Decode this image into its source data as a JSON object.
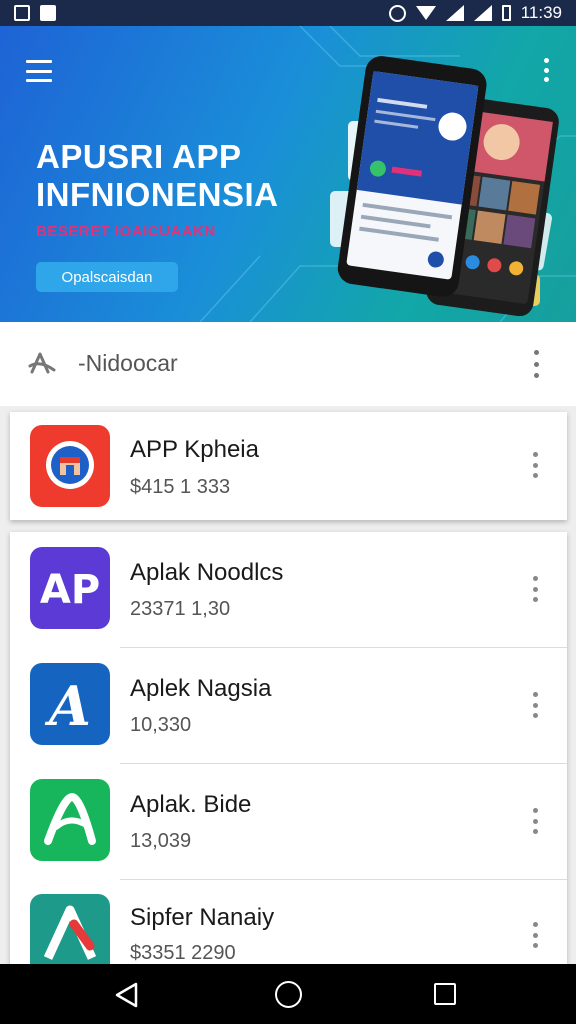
{
  "status_bar": {
    "time": "11:39",
    "left_icons": [
      "notification-icon",
      "mail-icon"
    ],
    "right_icons": [
      "alarm-icon",
      "wifi-icon",
      "signal-icon",
      "signal-icon",
      "battery-icon"
    ]
  },
  "hero": {
    "title_line1": "APUSRI APP",
    "title_line2": "INFNIONENSIA",
    "subtitle": "BESERET IOAICUAAKN",
    "button_label": "Opalscaisdan",
    "colors": {
      "gradient_start": "#1e63d6",
      "gradient_end": "#169f9d",
      "subtitle": "#e0327a",
      "button": "#2fa6ea"
    }
  },
  "search": {
    "text": "-Nidoocar",
    "icon": "search-icon"
  },
  "apps": [
    {
      "name": "APP Kpheia",
      "price": "$415 1 333",
      "icon": "shop-bag-icon",
      "color": "#ef3b2d"
    },
    {
      "name": "Aplak Noodlcs",
      "price": "23371 1,30",
      "icon": "ap-logo-icon",
      "color": "#5b3ad6"
    },
    {
      "name": "Aplek Nagsia",
      "price": "10,330",
      "icon": "a-letter-icon",
      "color": "#1565c0"
    },
    {
      "name": "Aplak. Bide",
      "price": "13,039",
      "icon": "leaf-a-icon",
      "color": "#18b65c"
    },
    {
      "name": "Sipfer Nanaiy",
      "price": "$3351 2290",
      "icon": "stylized-a-icon",
      "color": "#1d9a8a"
    }
  ],
  "nav": {
    "back": "back-icon",
    "home": "home-icon",
    "recent": "recent-apps-icon"
  }
}
